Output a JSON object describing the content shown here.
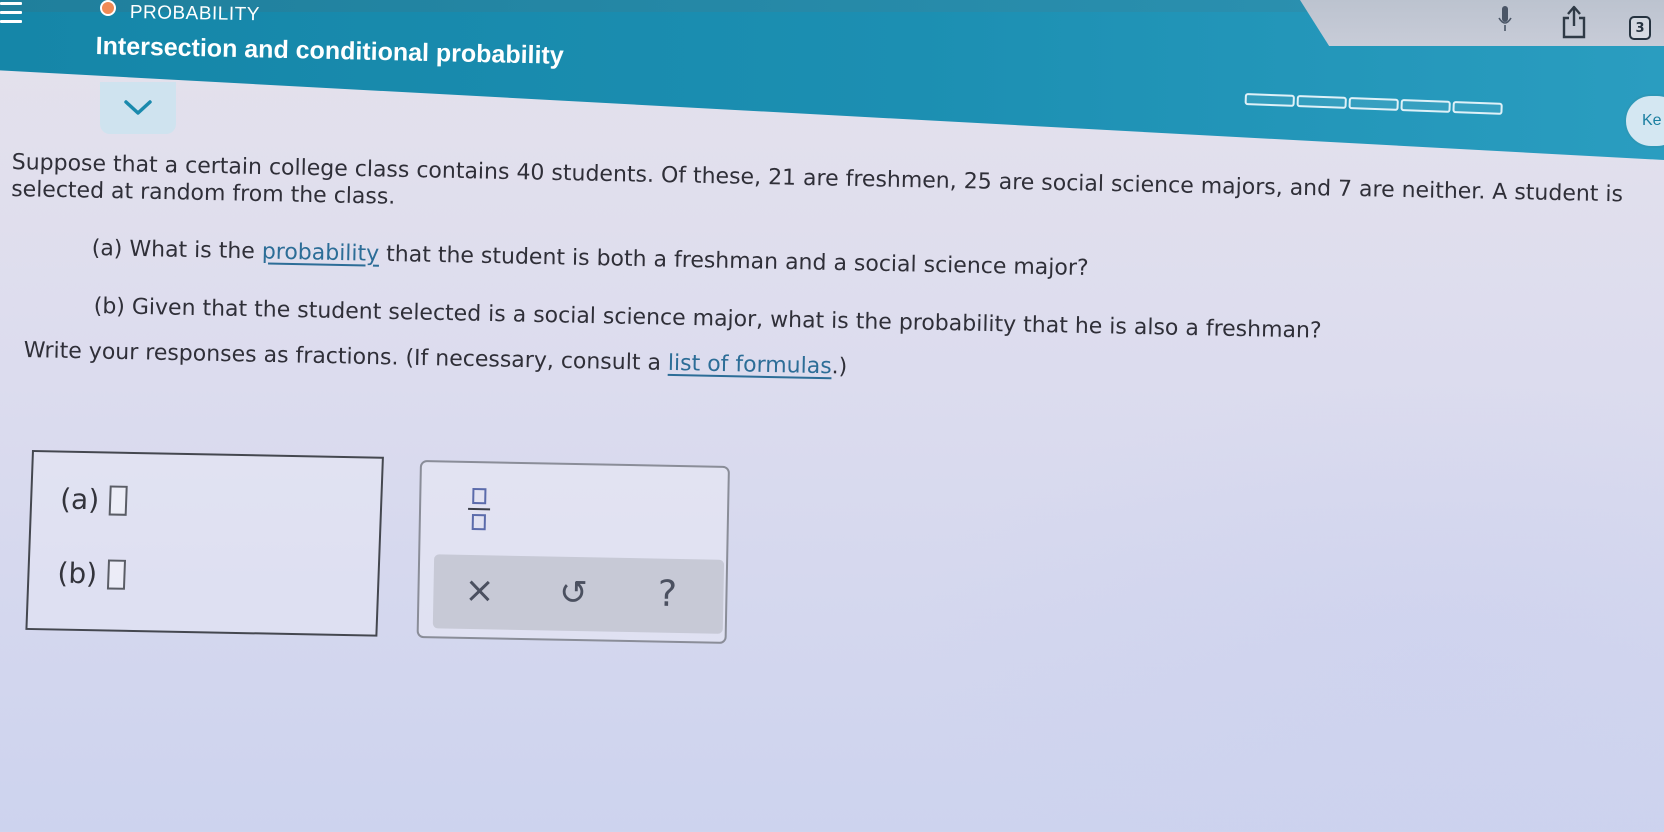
{
  "header": {
    "topic_label": "PROBABILITY",
    "lesson_title": "Intersection and conditional probability",
    "right_button_label": "Ke",
    "notification_count": "3",
    "progress_segments": 5
  },
  "problem": {
    "line1": "Suppose that a certain college class contains 40 students. Of these, 21 are freshmen, 25 are social science majors, and 7 are neither. A student is",
    "line2": "selected at random from the class.",
    "question_a_prefix": "(a) What is the ",
    "question_a_link": "probability",
    "question_a_suffix": " that the student is both a freshman and a social science major?",
    "question_b": "(b) Given that the student selected is a social science major, what is the probability that he is also a freshman?",
    "instructions_prefix": "Write your responses as fractions. (If necessary, consult a ",
    "instructions_link": "list of formulas",
    "instructions_suffix": ".)"
  },
  "answers": {
    "a_label": "(a)",
    "b_label": "(b)",
    "a_value": "",
    "b_value": ""
  },
  "keypad": {
    "clear_symbol": "×",
    "undo_symbol": "↺",
    "help_symbol": "?"
  },
  "colors": {
    "header": "#1a8aad",
    "link": "#2c6d97",
    "accent_record": "#f08a55"
  }
}
